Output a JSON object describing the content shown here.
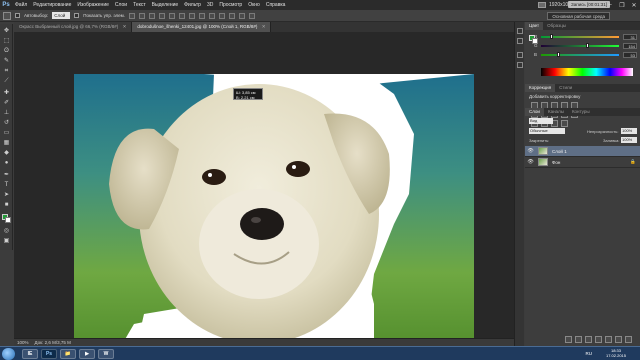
{
  "app": {
    "logo": "Ps",
    "screen_size": "1920x1080",
    "recording_badge": "Запись [00:01:31]"
  },
  "menu": [
    "Файл",
    "Редактирование",
    "Изображение",
    "Слои",
    "Текст",
    "Выделение",
    "Фильтр",
    "3D",
    "Просмотр",
    "Окно",
    "Справка"
  ],
  "window_controls": {
    "minimize": "–",
    "restore": "❐",
    "close": "✕"
  },
  "options": {
    "autoselect_label": "Автовыбор:",
    "autoselect_value": "Слой",
    "transform_label": "Показать упр. элем.",
    "workspace": "Основная рабочая среда"
  },
  "doc_tabs": [
    {
      "label": "Окрасс Выбранный слой.jpg @ 66,7% (RGB/8#)",
      "active": false
    },
    {
      "label": "dobrodušnoe_šhenki_12401.jpg @ 100% (Слой 1, RGB/8#)",
      "active": true
    }
  ],
  "canvas": {
    "tooltip_lines": [
      "Ш: 3,85 см",
      "В: 2,21 см"
    ]
  },
  "status": {
    "zoom": "100%",
    "doc_size": "Док: 2,6 М/3,75 М"
  },
  "color_panel": {
    "tabs": [
      "Цвет",
      "Образцы"
    ],
    "sliders": [
      {
        "letter": "R",
        "value": "31",
        "level": 0.12
      },
      {
        "letter": "G",
        "value": "154",
        "level": 0.6
      },
      {
        "letter": "B",
        "value": "53",
        "level": 0.21
      }
    ]
  },
  "adjust_panel": {
    "tabs": [
      "Коррекция",
      "Стили"
    ],
    "title": "Добавить корректировку"
  },
  "layers_panel": {
    "tabs": [
      "Слои",
      "Каналы",
      "Контуры"
    ],
    "kind_filter": "Вид",
    "blend_mode": "Обычные",
    "opacity_label": "Непрозрачность:",
    "opacity_value": "100%",
    "lock_label": "Закрепить:",
    "fill_label": "Заливка:",
    "fill_value": "100%",
    "layers": [
      {
        "name": "Слой 1",
        "selected": true,
        "lock": ""
      },
      {
        "name": "Фон",
        "selected": false,
        "lock": "🔒"
      }
    ]
  },
  "taskbar": {
    "apps": [
      "IE",
      "Ps",
      "📁",
      "▶",
      "W"
    ],
    "lang": "RU",
    "time": "18:33",
    "date": "17.02.2015"
  },
  "colors": {
    "foreground": "#1f9a35",
    "background": "#ffffff",
    "accent": "#5f6f86"
  }
}
